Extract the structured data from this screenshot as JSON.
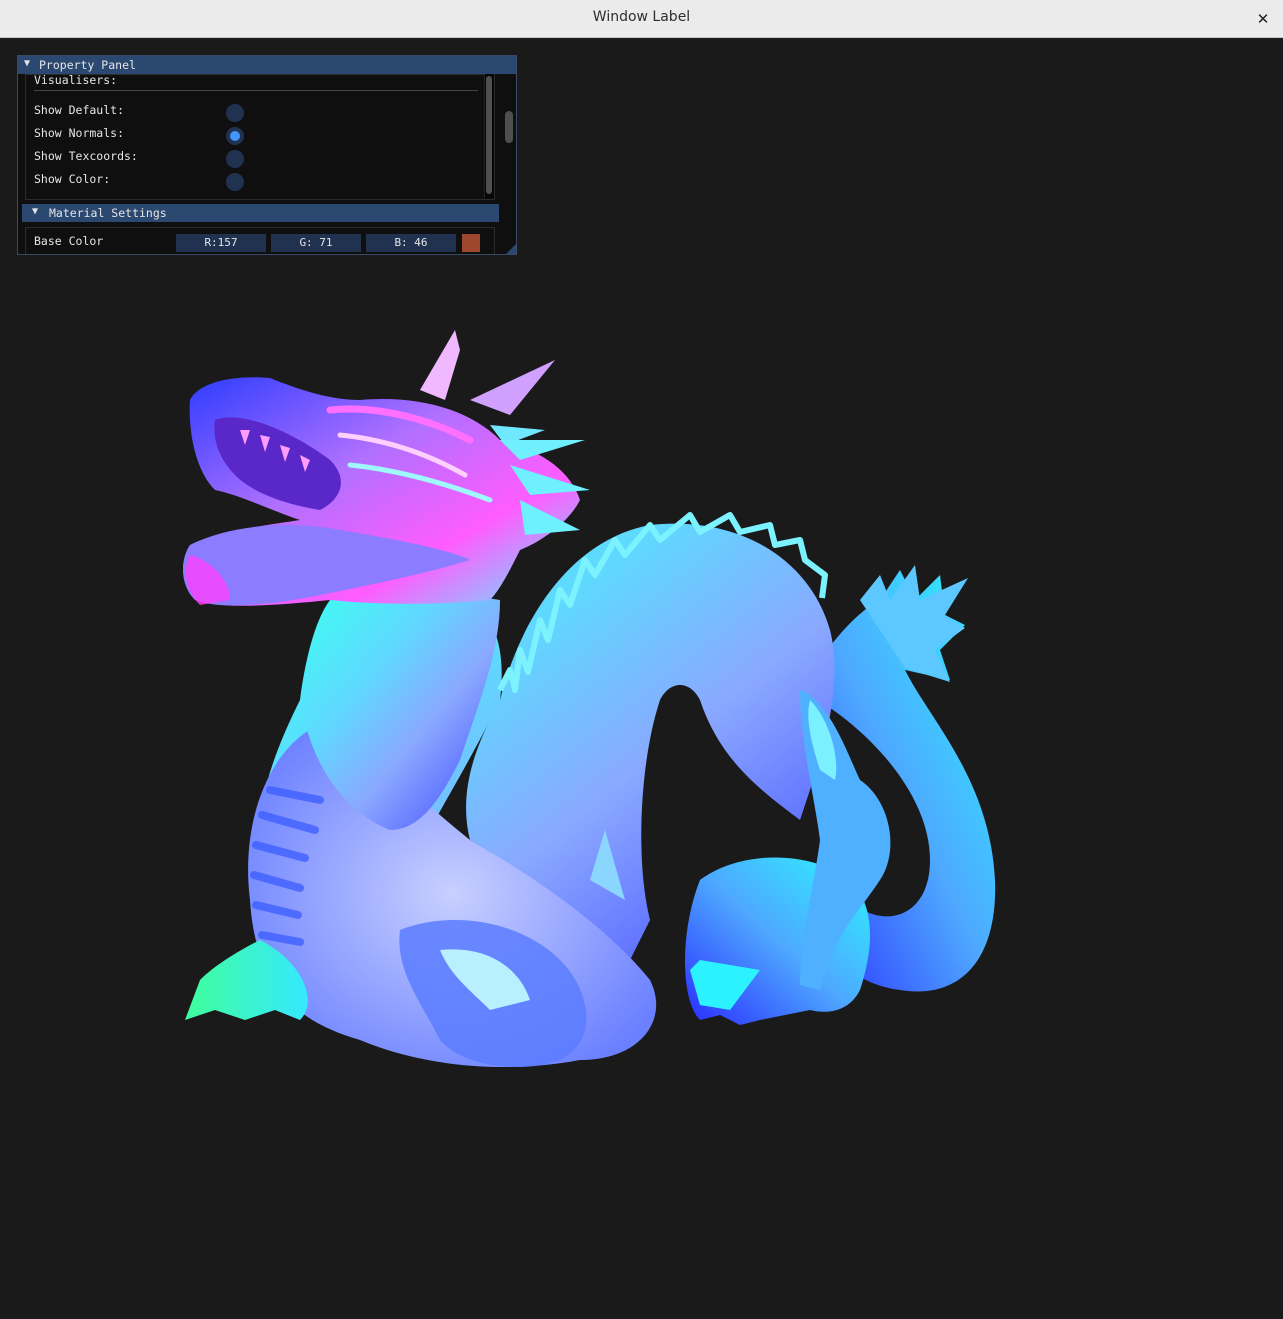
{
  "window": {
    "title": "Window Label",
    "close_glyph": "✕"
  },
  "panel": {
    "title": "Property Panel",
    "collapse_glyph": "▼",
    "visualisers": {
      "heading": "Visualisers:",
      "items": [
        {
          "label": "Show Default:",
          "selected": false
        },
        {
          "label": "Show Normals:",
          "selected": true
        },
        {
          "label": "Show Texcoords:",
          "selected": false
        },
        {
          "label": "Show Color:",
          "selected": false
        }
      ]
    },
    "material": {
      "header": "Material Settings",
      "collapse_glyph": "▼",
      "base_color_label": "Base Color",
      "r_text": "R:157",
      "g_text": "G: 71",
      "b_text": "B: 46",
      "swatch_color": "#9d472e"
    }
  },
  "viewport": {
    "background": "#1a1a1a",
    "scene": "dragon-mesh-normals-visualisation"
  },
  "colors": {
    "accent": "#4296fa",
    "header": "#2a4870",
    "frame": "#213250"
  }
}
